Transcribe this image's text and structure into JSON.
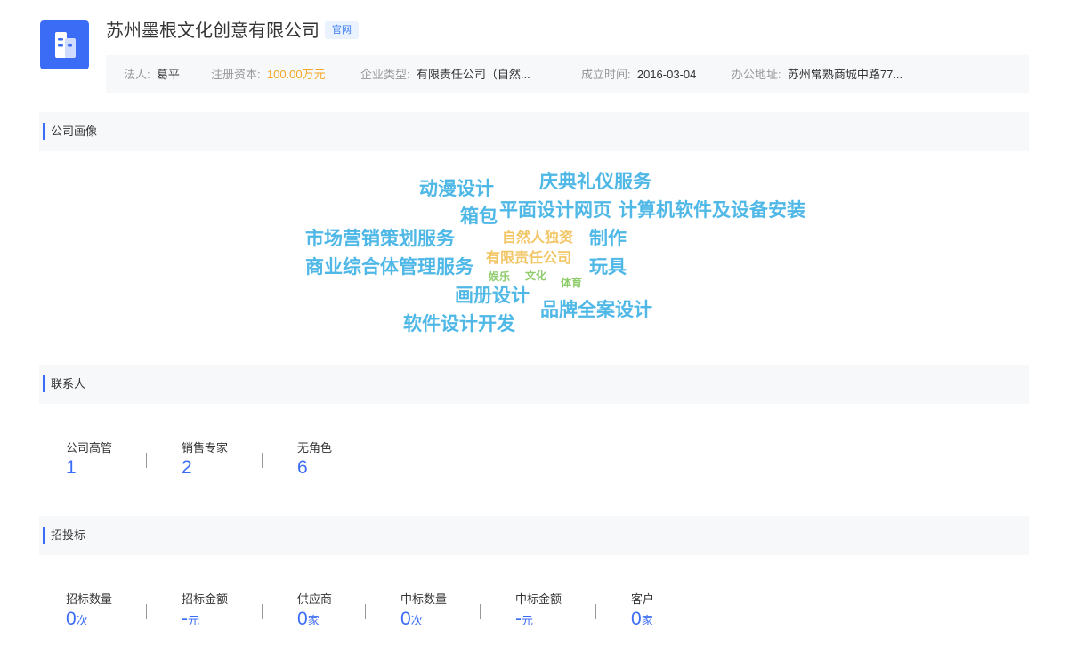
{
  "company": {
    "name": "苏州墨根文化创意有限公司",
    "badge": "官网"
  },
  "info": [
    {
      "key": "法人:",
      "value": "葛平"
    },
    {
      "key": "注册资本:",
      "value": "100.00万元"
    },
    {
      "key": "企业类型:",
      "value": "有限责任公司（自然..."
    },
    {
      "key": "成立时间:",
      "value": "2016-03-04"
    },
    {
      "key": "办公地址:",
      "value": "苏州常熟商城中路77..."
    }
  ],
  "sections": {
    "portrait": "公司画像",
    "contacts": "联系人",
    "bidding": "招投标"
  },
  "word_cloud": [
    {
      "text": "动漫设计",
      "color": "#4fb8e6"
    },
    {
      "text": "庆典礼仪服务",
      "color": "#4fb8e6"
    },
    {
      "text": "箱包",
      "color": "#4fb8e6"
    },
    {
      "text": "平面设计网页",
      "color": "#4fb8e6"
    },
    {
      "text": "计算机软件及设备安装",
      "color": "#4fb8e6"
    },
    {
      "text": "市场营销策划服务",
      "color": "#4fb8e6"
    },
    {
      "text": "自然人独资",
      "color": "#f2c666"
    },
    {
      "text": "制作",
      "color": "#4fb8e6"
    },
    {
      "text": "商业综合体管理服务",
      "color": "#4fb8e6"
    },
    {
      "text": "有限责任公司",
      "color": "#f2c666"
    },
    {
      "text": "玩具",
      "color": "#4fb8e6"
    },
    {
      "text": "娱乐",
      "color": "#8fcc6b"
    },
    {
      "text": "文化",
      "color": "#8fcc6b"
    },
    {
      "text": "体育",
      "color": "#8fcc6b"
    },
    {
      "text": "画册设计",
      "color": "#4fb8e6"
    },
    {
      "text": "品牌全案设计",
      "color": "#4fb8e6"
    },
    {
      "text": "软件设计开发",
      "color": "#4fb8e6"
    }
  ],
  "contacts": [
    {
      "label": "公司高管",
      "value": "1"
    },
    {
      "label": "销售专家",
      "value": "2"
    },
    {
      "label": "无角色",
      "value": "6"
    }
  ],
  "bidding": [
    {
      "label": "招标数量",
      "value": "0",
      "unit": "次"
    },
    {
      "label": "招标金额",
      "value": "-",
      "unit": "元"
    },
    {
      "label": "供应商",
      "value": "0",
      "unit": "家"
    },
    {
      "label": "中标数量",
      "value": "0",
      "unit": "次"
    },
    {
      "label": "中标金额",
      "value": "-",
      "unit": "元"
    },
    {
      "label": "客户",
      "value": "0",
      "unit": "家"
    }
  ]
}
